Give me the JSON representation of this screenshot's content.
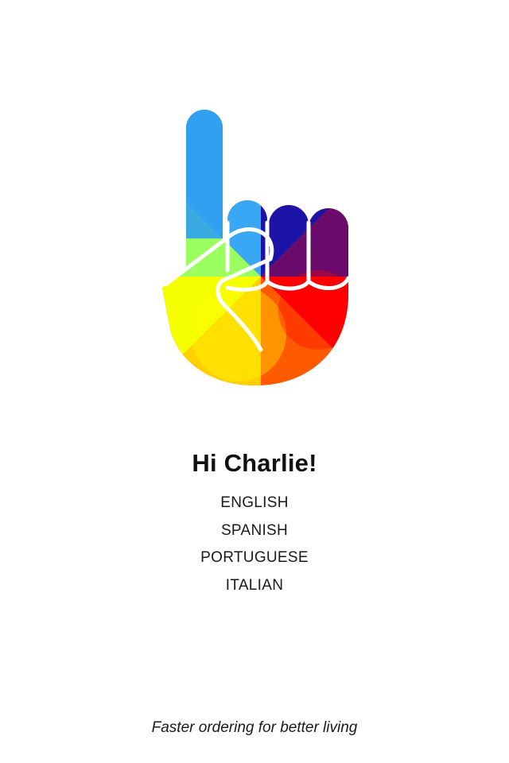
{
  "app": {
    "logo_icon": "pointing-hand-icon"
  },
  "welcome": {
    "greeting": "Hi Charlie!"
  },
  "languages": [
    {
      "label": "ENGLISH"
    },
    {
      "label": "SPANISH"
    },
    {
      "label": "PORTUGUESE"
    },
    {
      "label": "ITALIAN"
    }
  ],
  "footer": {
    "tagline": "Faster ordering for better living"
  },
  "colors": {
    "background": "#ffffff",
    "text": "#111111",
    "logo_blue": "#2f9ef0",
    "logo_navy": "#1a10a0",
    "logo_purple": "#5a0a70",
    "logo_red": "#ff0000",
    "logo_yellow": "#ffff00",
    "logo_green": "#90ff70"
  }
}
